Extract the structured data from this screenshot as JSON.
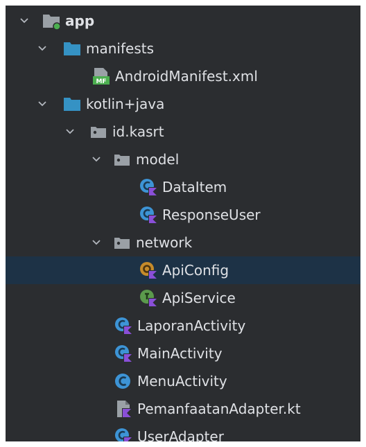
{
  "colors": {
    "panel_bg": "#2b2d30",
    "selection_bg": "#1d3246",
    "text": "#dfe1e5",
    "folder_blue": "#3592c4",
    "package_gray": "#9aa0a6",
    "class_blue": "#3d94d6",
    "object_orange": "#c68b2a",
    "interface_green": "#5b9a4c",
    "kotlin_purple": "#8a4fd8",
    "module_green": "#4caf50"
  },
  "tree": {
    "rows": [
      {
        "label": "app",
        "icon": "module-folder-icon",
        "expanded": true
      },
      {
        "label": "manifests",
        "icon": "folder-icon",
        "expanded": true
      },
      {
        "label": "AndroidManifest.xml",
        "icon": "manifest-file-icon",
        "icon_badge": "MF"
      },
      {
        "label": "kotlin+java",
        "icon": "source-folder-icon",
        "expanded": true
      },
      {
        "label": "id.kasrt",
        "icon": "package-icon",
        "expanded": true
      },
      {
        "label": "model",
        "icon": "package-icon",
        "expanded": true
      },
      {
        "label": "DataItem",
        "icon": "kotlin-class-icon"
      },
      {
        "label": "ResponseUser",
        "icon": "kotlin-class-icon"
      },
      {
        "label": "network",
        "icon": "package-icon",
        "expanded": true
      },
      {
        "label": "ApiConfig",
        "icon": "kotlin-object-icon",
        "selected": true
      },
      {
        "label": "ApiService",
        "icon": "kotlin-interface-icon"
      },
      {
        "label": "LaporanActivity",
        "icon": "kotlin-class-icon"
      },
      {
        "label": "MainActivity",
        "icon": "kotlin-class-icon"
      },
      {
        "label": "MenuActivity",
        "icon": "java-class-icon"
      },
      {
        "label": "PemanfaatanAdapter.kt",
        "icon": "kotlin-file-icon"
      },
      {
        "label": "UserAdapter",
        "icon": "kotlin-class-icon"
      }
    ]
  }
}
